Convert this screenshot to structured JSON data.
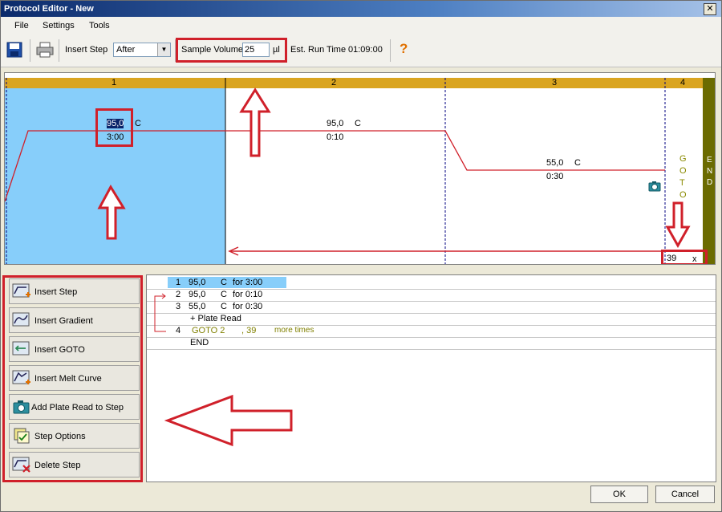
{
  "window": {
    "title": "Protocol Editor - New",
    "close_label": "✕"
  },
  "menu": {
    "file": "File",
    "settings": "Settings",
    "tools": "Tools"
  },
  "toolbar": {
    "insert_step_label": "Insert Step",
    "insert_position": "After",
    "sample_volume_label": "Sample Volume",
    "sample_volume_value": "25",
    "sample_volume_unit": "µl",
    "est_run_time_label": "Est. Run Time",
    "est_run_time_value": "01:09:00",
    "help_glyph": "?"
  },
  "graph": {
    "steps": [
      "1",
      "2",
      "3",
      "4"
    ],
    "step1": {
      "temp": "95,0",
      "unit": "C",
      "time": "3:00"
    },
    "step2": {
      "temp": "95,0",
      "unit": "C",
      "time": "0:10"
    },
    "step3": {
      "temp": "55,0",
      "unit": "C",
      "time": "0:30"
    },
    "goto_letters": [
      "G",
      "O",
      "T",
      "O"
    ],
    "end_letters": [
      "E",
      "N",
      "D"
    ],
    "repeat_count": "39",
    "repeat_suffix": "x"
  },
  "left_buttons": [
    {
      "label": "Insert Step"
    },
    {
      "label": "Insert Gradient"
    },
    {
      "label": "Insert GOTO"
    },
    {
      "label": "Insert Melt Curve"
    },
    {
      "label": "Add Plate Read to Step"
    },
    {
      "label": "Step Options"
    },
    {
      "label": "Delete Step"
    }
  ],
  "step_list": [
    {
      "num": "1",
      "temp": "95,0",
      "unit": "C",
      "for_text": "for 3:00"
    },
    {
      "num": "2",
      "temp": "95,0",
      "unit": "C",
      "for_text": "for 0:10"
    },
    {
      "num": "3",
      "temp": "55,0",
      "unit": "C",
      "for_text": "for 0:30"
    },
    {
      "plate_read": "+ Plate Read"
    },
    {
      "num": "4",
      "goto": "GOTO  2",
      "count": ", 39",
      "more": "more times"
    },
    {
      "end": "END"
    }
  ],
  "footer": {
    "ok": "OK",
    "cancel": "Cancel"
  },
  "colors": {
    "accent_red": "#d0202a",
    "step_bar": "#daa520",
    "selected_step": "#87cefa",
    "end_bar": "#6b6b00",
    "goto_text": "#8a8a00"
  }
}
